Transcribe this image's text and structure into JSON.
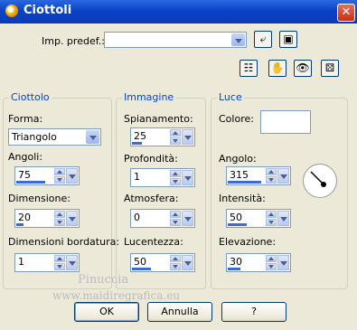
{
  "window": {
    "title": "Ciottoli",
    "close_glyph": "✕"
  },
  "preset": {
    "label": "Imp. predef.:",
    "value": ""
  },
  "toolbar": {
    "reset_icon": "⤶",
    "save_icon": "▣",
    "icons": [
      "calculator-icon",
      "eye-hand-icon",
      "eye-icon",
      "dice-icon"
    ],
    "glyphs": [
      "☷",
      "✋",
      "👁",
      "⚄"
    ]
  },
  "groups": {
    "ciottolo": {
      "title": "Ciottolo",
      "forma_label": "Forma:",
      "forma_value": "Triangolo",
      "angoli_label": "Angoli:",
      "angoli_value": "75",
      "angoli_level": 0.75,
      "dimensione_label": "Dimensione:",
      "dimensione_value": "20",
      "dimensione_level": 0.2,
      "bordatura_label": "Dimensioni bordatura:",
      "bordatura_value": "1",
      "bordatura_level": 0.01
    },
    "immagine": {
      "title": "Immagine",
      "spianamento_label": "Spianamento:",
      "spianamento_value": "25",
      "spianamento_level": 0.25,
      "profondita_label": "Profondità:",
      "profondita_value": "1",
      "profondita_level": 0.01,
      "atmosfera_label": "Atmosfera:",
      "atmosfera_value": "0",
      "atmosfera_level": 0,
      "lucentezza_label": "Lucentezza:",
      "lucentezza_value": "50",
      "lucentezza_level": 0.5
    },
    "luce": {
      "title": "Luce",
      "colore_label": "Colore:",
      "colore_value": "#ffffff",
      "angolo_label": "Angolo:",
      "angolo_value": "315",
      "angolo_level": 0.875,
      "intensita_label": "Intensità:",
      "intensita_value": "50",
      "intensita_level": 0.5,
      "elevazione_label": "Elevazione:",
      "elevazione_value": "30",
      "elevazione_level": 0.33
    }
  },
  "buttons": {
    "ok": "OK",
    "cancel": "Annulla",
    "help": "?"
  },
  "watermark": {
    "line1": "Pinuccia",
    "line2": "www.maidiregrafica.eu"
  }
}
